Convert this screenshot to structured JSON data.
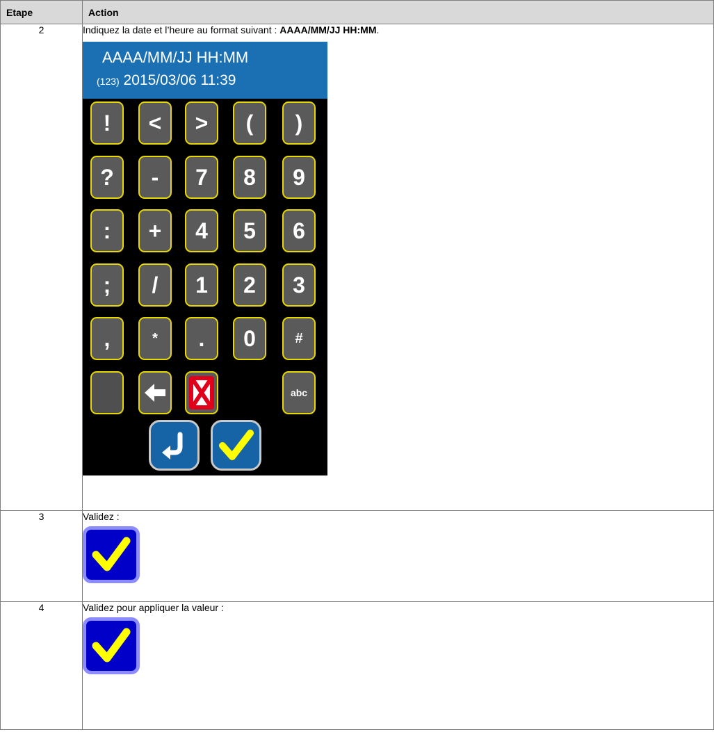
{
  "table": {
    "header": {
      "step": "Etape",
      "action": "Action"
    },
    "rows": [
      {
        "step": "2",
        "text_before": "Indiquez la date et l’heure au format suivant : ",
        "text_bold": "AAAA/MM/JJ HH:MM",
        "text_after": "."
      },
      {
        "step": "3",
        "text": "Validez :"
      },
      {
        "step": "4",
        "text": "Validez pour appliquer la valeur :"
      }
    ]
  },
  "keypad": {
    "format": "AAAA/MM/JJ HH:MM",
    "value_prefix": "(123)",
    "value": "2015/03/06 11:39",
    "keys": [
      [
        "!",
        "<",
        ">",
        "(",
        ")"
      ],
      [
        "?",
        "-",
        "7",
        "8",
        "9"
      ],
      [
        ":",
        "+",
        "4",
        "5",
        "6"
      ],
      [
        ";",
        "/",
        "1",
        "2",
        "3"
      ],
      [
        ",",
        "*",
        ".",
        "0",
        "#"
      ]
    ],
    "abc_label": "abc",
    "bottom_icons": [
      "back-arrow-icon",
      "cancel-x-icon",
      "enter-icon",
      "check-icon"
    ]
  },
  "colors": {
    "header_bg": "#1a70b3",
    "key_border": "#e9d800",
    "key_bg": "#5a5a5a",
    "cancel_red": "#e0001b",
    "validate_blue": "#0000c8",
    "check_yellow": "#ffff00"
  }
}
